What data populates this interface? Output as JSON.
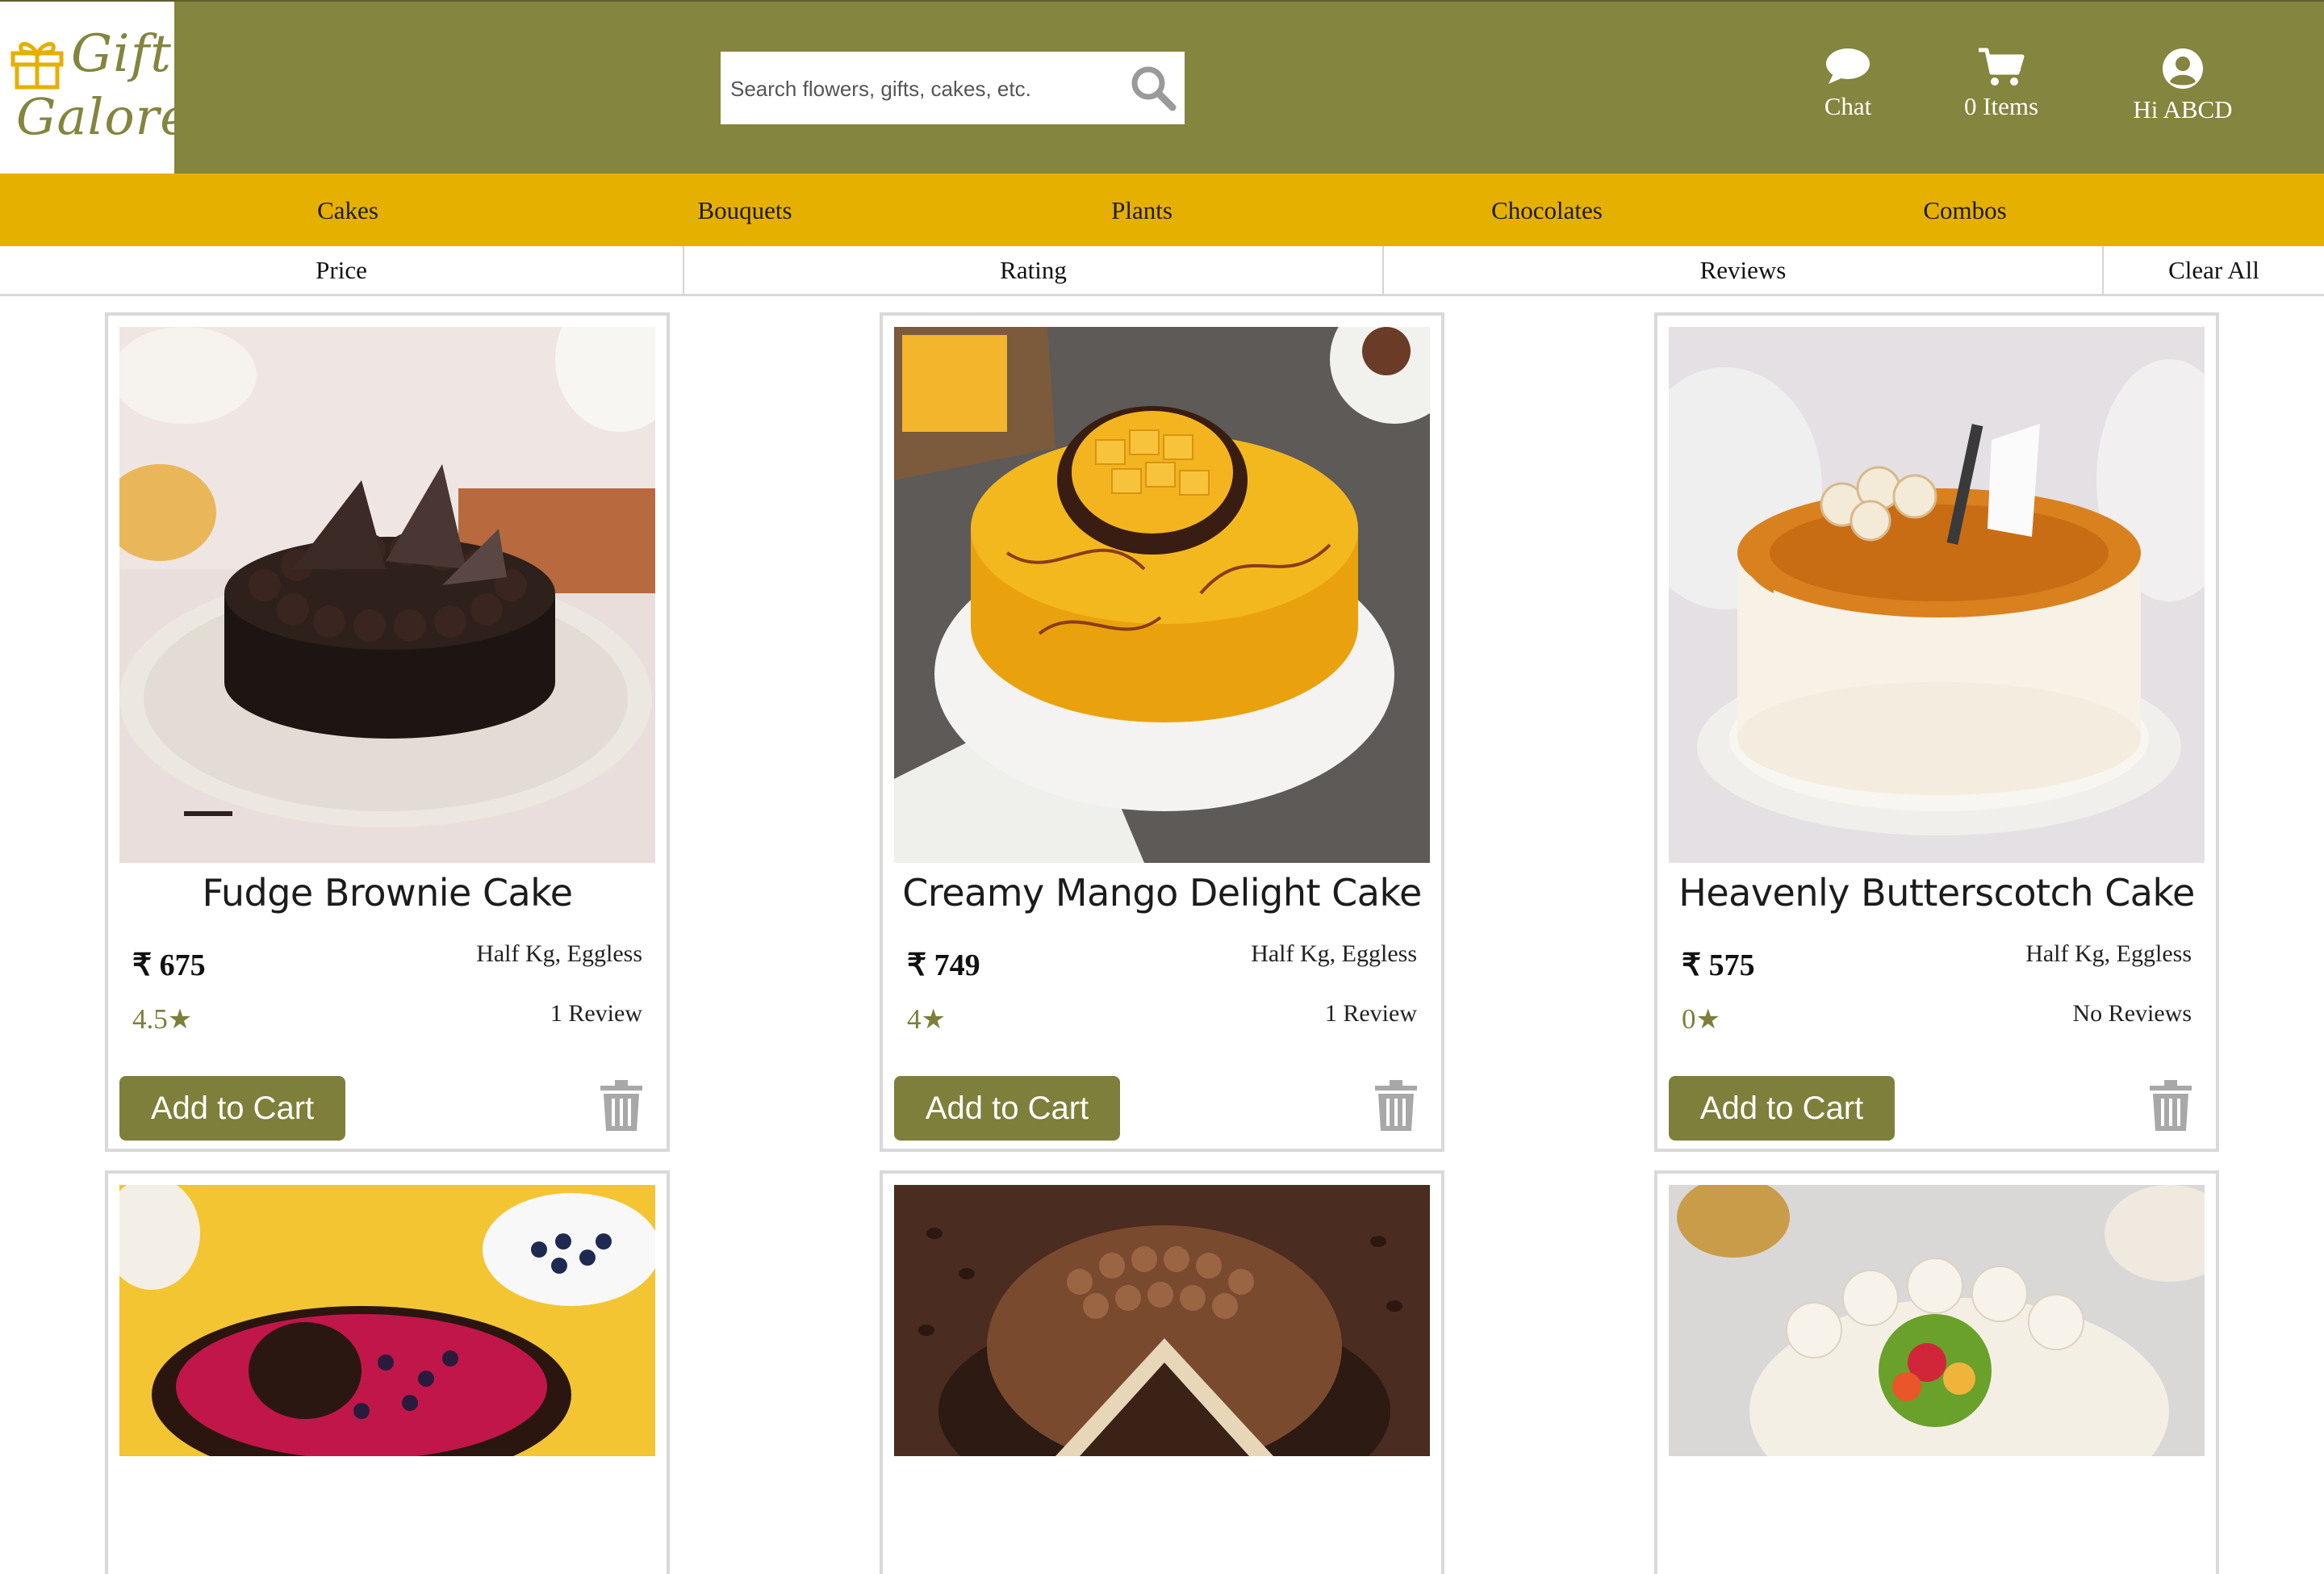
{
  "brand": {
    "name_line1": "Gift",
    "name_line2": "Galore"
  },
  "search": {
    "placeholder": "Search flowers, gifts, cakes, etc."
  },
  "header": {
    "chat_label": "Chat",
    "cart_label": "0 Items",
    "user_label": "Hi ABCD"
  },
  "categories": [
    "Cakes",
    "Bouquets",
    "Plants",
    "Chocolates",
    "Combos"
  ],
  "filters": {
    "price": "Price",
    "rating": "Rating",
    "reviews": "Reviews",
    "clear": "Clear All"
  },
  "products": [
    {
      "name": "Fudge Brownie Cake",
      "price": "₹ 675",
      "variant": "Half Kg, Eggless",
      "rating": "4.5",
      "reviews": "1 Review",
      "button": "Add to Cart"
    },
    {
      "name": "Creamy Mango Delight Cake",
      "price": "₹ 749",
      "variant": "Half Kg, Eggless",
      "rating": "4",
      "reviews": "1 Review",
      "button": "Add to Cart"
    },
    {
      "name": "Heavenly Butterscotch Cake",
      "price": "₹ 575",
      "variant": "Half Kg, Eggless",
      "rating": "0",
      "reviews": "No Reviews",
      "button": "Add to Cart"
    }
  ],
  "colors": {
    "header": "#84853e",
    "nav": "#e6b000",
    "accent": "#7e7f3b"
  },
  "icons": {
    "search": "search-icon",
    "chat": "chat-bubble-icon",
    "cart": "shopping-cart-icon",
    "user": "user-circle-icon",
    "delete": "trash-icon",
    "rating": "star-icon"
  }
}
